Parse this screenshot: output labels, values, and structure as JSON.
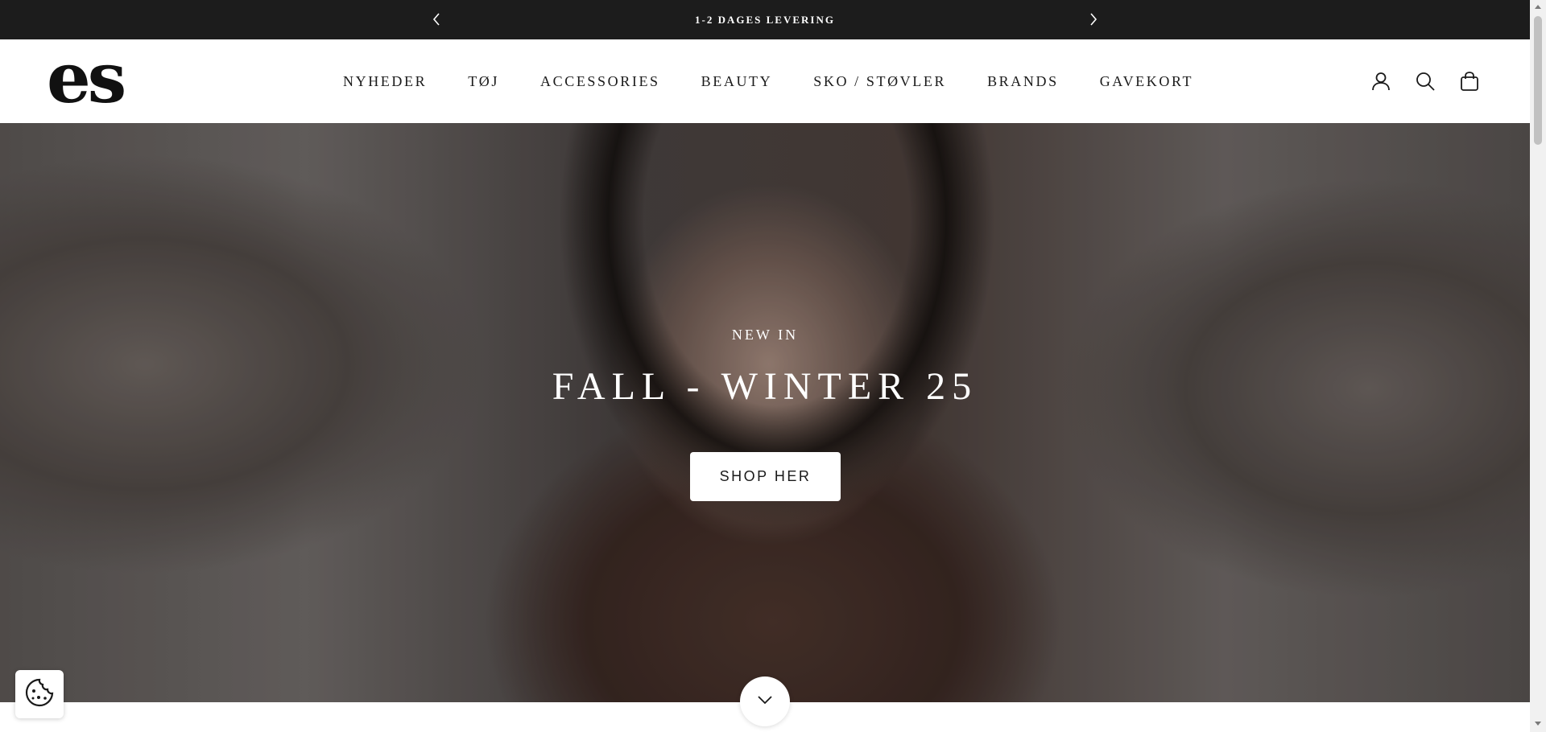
{
  "announcement": {
    "message": "1-2 DAGES LEVERING",
    "prev_icon": "chevron-left-icon",
    "next_icon": "chevron-right-icon"
  },
  "header": {
    "logo_text": "es",
    "nav": [
      {
        "label": "NYHEDER"
      },
      {
        "label": "TØJ"
      },
      {
        "label": "ACCESSORIES"
      },
      {
        "label": "BEAUTY"
      },
      {
        "label": "SKO / STØVLER"
      },
      {
        "label": "BRANDS"
      },
      {
        "label": "GAVEKORT"
      }
    ],
    "icons": [
      "account-icon",
      "search-icon",
      "cart-icon"
    ]
  },
  "hero": {
    "eyebrow": "NEW IN",
    "title": "FALL - WINTER 25",
    "cta_label": "SHOP HER"
  },
  "colors": {
    "announcement_bg": "#1c1c1c",
    "header_bg": "#ffffff",
    "text": "#1a1a1a",
    "hero_text": "#ffffff"
  }
}
